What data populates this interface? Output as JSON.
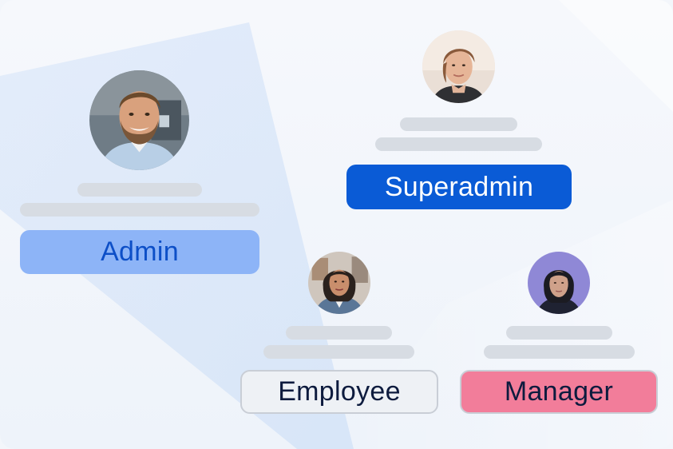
{
  "roles": {
    "admin": {
      "label": "Admin",
      "avatar_icon": "smiling-man-avatar"
    },
    "superadmin": {
      "label": "Superadmin",
      "avatar_icon": "woman-avatar"
    },
    "employee": {
      "label": "Employee",
      "avatar_icon": "woman-with-denim-jacket-avatar"
    },
    "manager": {
      "label": "Manager",
      "avatar_icon": "woman-dark-hair-avatar"
    }
  },
  "colors": {
    "admin_fill": "#8db4f7",
    "admin_text": "#0d4fc7",
    "superadmin_fill": "#0a5bd6",
    "superadmin_text": "#ffffff",
    "employee_fill": "#eef1f5",
    "manager_fill": "#f27d9a",
    "placeholder_bar": "#d7dce3",
    "beam": "#cfe0f8"
  }
}
